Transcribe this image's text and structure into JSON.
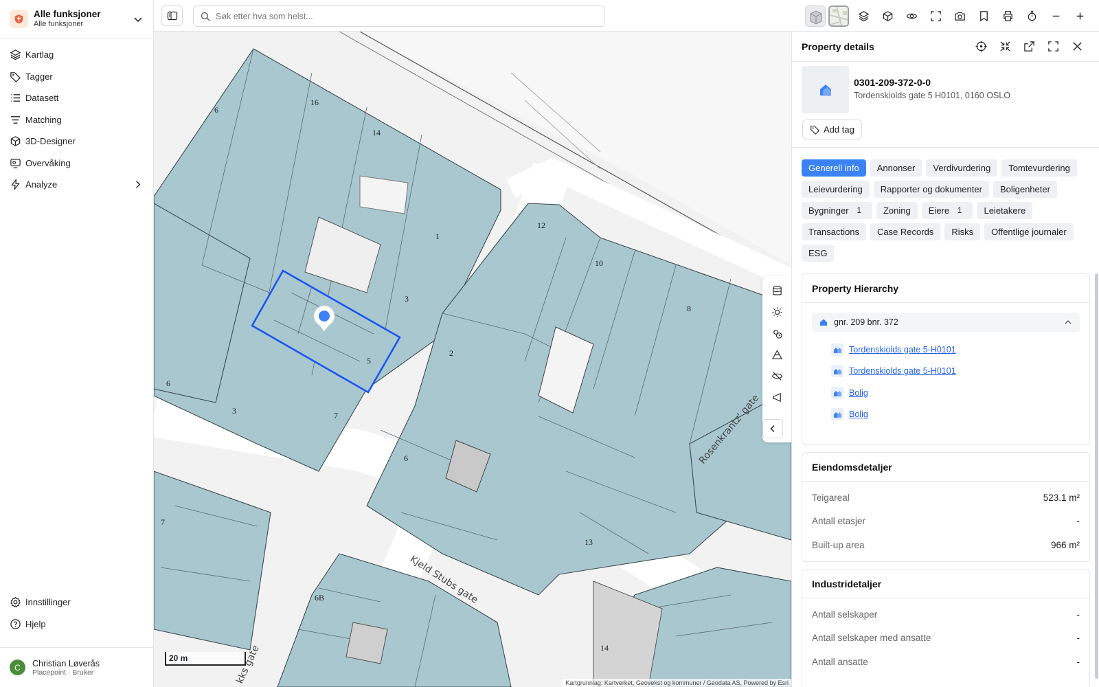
{
  "workspace": {
    "title": "Alle funksjoner",
    "subtitle": "Alle funksjoner"
  },
  "sidebar": {
    "items": [
      {
        "label": "Kartlag"
      },
      {
        "label": "Tagger"
      },
      {
        "label": "Datasett"
      },
      {
        "label": "Matching"
      },
      {
        "label": "3D-Designer"
      },
      {
        "label": "Overvåking"
      },
      {
        "label": "Analyze"
      }
    ],
    "bottom": [
      {
        "label": "Innstillinger"
      },
      {
        "label": "Hjelp"
      }
    ]
  },
  "user": {
    "initial": "C",
    "name": "Christian Løverås",
    "role": "Placepoint · Bruker"
  },
  "search": {
    "placeholder": "Søk etter hva som helst..."
  },
  "map": {
    "scale_label": "20 m",
    "attribution": "Kartgrunnlag: Kartverket, Geovekst og kommuner / Geodata AS, Powered by Esri",
    "street_labels": {
      "kjeld": "Kjeld Stubs gate",
      "rosenkrantz": "Rosenkrantz' gate",
      "other": "kks gate"
    },
    "house_numbers": {
      "n16": "16",
      "n14": "14",
      "n1": "1",
      "n3a": "3",
      "n5": "5",
      "n2": "2",
      "n6a": "6",
      "n6b": "6",
      "n6c": "6",
      "n3b": "3",
      "n7a": "7",
      "n7b": "7",
      "n12": "12",
      "n10": "10",
      "n8": "8",
      "n13": "13",
      "n6B": "6B",
      "n14b": "14"
    }
  },
  "panel": {
    "title": "Property details",
    "property_id": "0301-209-372-0-0",
    "address": "Tordenskiolds gate 5 H0101, 0160 OSLO",
    "add_tag": "Add tag",
    "tabs": [
      {
        "label": "Generell info",
        "active": true
      },
      {
        "label": "Annonser"
      },
      {
        "label": "Verdivurdering"
      },
      {
        "label": "Tomtevurdering"
      },
      {
        "label": "Leievurdering"
      },
      {
        "label": "Rapporter og dokumenter"
      },
      {
        "label": "Boligenheter"
      },
      {
        "label": "Bygninger",
        "count": "1"
      },
      {
        "label": "Zoning"
      },
      {
        "label": "Eiere",
        "count": "1"
      },
      {
        "label": "Leietakere"
      },
      {
        "label": "Transactions"
      },
      {
        "label": "Case Records"
      },
      {
        "label": "Risks"
      },
      {
        "label": "Offentlige journaler"
      },
      {
        "label": "ESG"
      }
    ],
    "hierarchy": {
      "title": "Property Hierarchy",
      "root": "gnr. 209 bnr. 372",
      "children": [
        "Tordenskiolds gate 5-H0101",
        "Tordenskiolds gate 5-H0101",
        "Bolig",
        "Bolig"
      ]
    },
    "eiendom": {
      "title": "Eiendomsdetaljer",
      "rows": [
        {
          "key": "Teigareal",
          "value": "523.1 m²"
        },
        {
          "key": "Antall etasjer",
          "value": "-"
        },
        {
          "key": "Built-up area",
          "value": "966 m²"
        }
      ]
    },
    "industri": {
      "title": "Industridetaljer",
      "rows": [
        {
          "key": "Antall selskaper",
          "value": "-"
        },
        {
          "key": "Antall selskaper med ansatte",
          "value": "-"
        },
        {
          "key": "Antall ansatte",
          "value": "-"
        }
      ]
    }
  }
}
